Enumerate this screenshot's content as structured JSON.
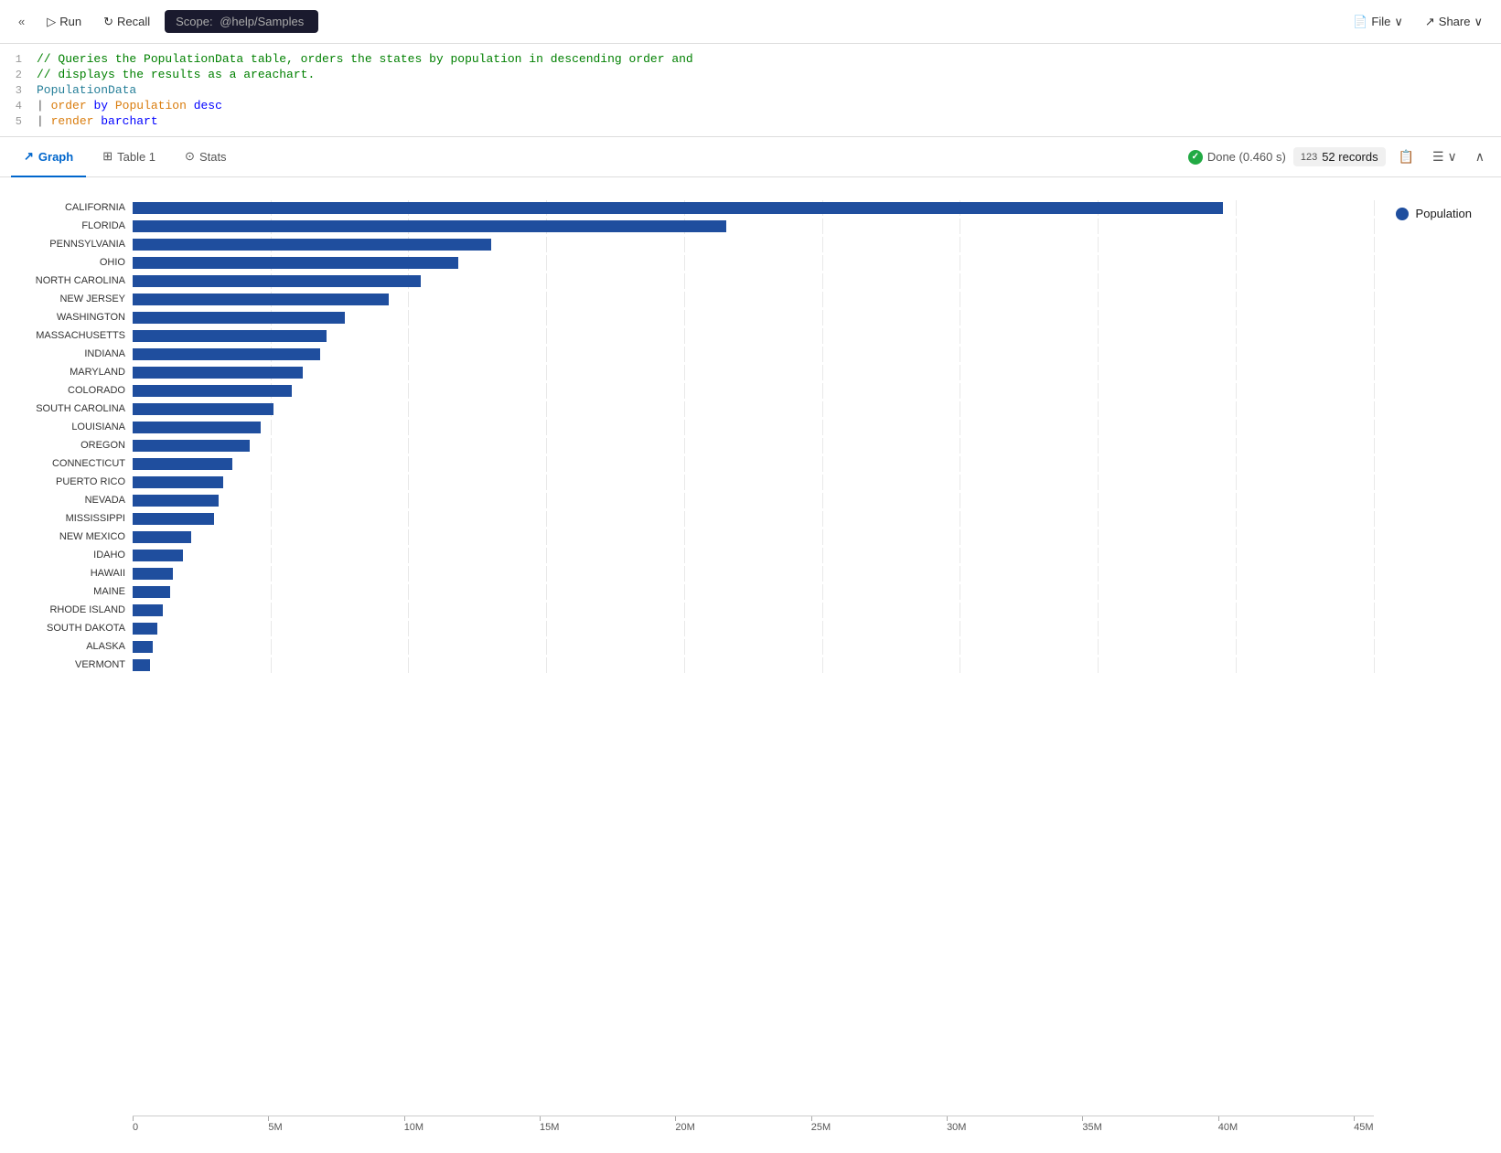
{
  "toolbar": {
    "back_label": "«",
    "run_label": "Run",
    "recall_label": "Recall",
    "scope_prefix": "Scope:",
    "scope_value": "@help/Samples",
    "file_label": "File",
    "share_label": "Share"
  },
  "code": {
    "lines": [
      {
        "num": "1",
        "content": "comment1",
        "text": "// Queries the PopulationData table, orders the states by population in descending order and"
      },
      {
        "num": "2",
        "content": "comment2",
        "text": "// displays the results as a areachart."
      },
      {
        "num": "3",
        "content": "type",
        "text": "PopulationData"
      },
      {
        "num": "4",
        "content": "pipe_order",
        "text": "| order by Population desc"
      },
      {
        "num": "5",
        "content": "pipe_render",
        "text": "| render    barchart"
      }
    ]
  },
  "results": {
    "tabs": [
      {
        "id": "graph",
        "label": "Graph",
        "icon": "📈",
        "active": true
      },
      {
        "id": "table1",
        "label": "Table 1",
        "icon": "⊞",
        "active": false
      },
      {
        "id": "stats",
        "label": "Stats",
        "icon": "⊙",
        "active": false
      }
    ],
    "status": "Done (0.460 s)",
    "records_icon": "123",
    "records_count": "52 records"
  },
  "chart": {
    "legend_label": "Population",
    "x_ticks": [
      "0",
      "5M",
      "10M",
      "15M",
      "20M",
      "25M",
      "30M",
      "35M",
      "40M",
      "45M"
    ],
    "max_value": 45000000,
    "bars": [
      {
        "label": "CALIFORNIA",
        "value": 39538223
      },
      {
        "label": "FLORIDA",
        "value": 21538187
      },
      {
        "label": "PENNSYLVANIA",
        "value": 13002700
      },
      {
        "label": "OHIO",
        "value": 11799448
      },
      {
        "label": "NORTH CAROLINA",
        "value": 10439388
      },
      {
        "label": "NEW JERSEY",
        "value": 9288994
      },
      {
        "label": "WASHINGTON",
        "value": 7705281
      },
      {
        "label": "MASSACHUSETTS",
        "value": 7029917
      },
      {
        "label": "INDIANA",
        "value": 6785528
      },
      {
        "label": "MARYLAND",
        "value": 6177224
      },
      {
        "label": "COLORADO",
        "value": 5773714
      },
      {
        "label": "SOUTH CAROLINA",
        "value": 5118425
      },
      {
        "label": "LOUISIANA",
        "value": 4657757
      },
      {
        "label": "OREGON",
        "value": 4237256
      },
      {
        "label": "CONNECTICUT",
        "value": 3605944
      },
      {
        "label": "PUERTO RICO",
        "value": 3285874
      },
      {
        "label": "NEVADA",
        "value": 3104614
      },
      {
        "label": "MISSISSIPPI",
        "value": 2961279
      },
      {
        "label": "NEW MEXICO",
        "value": 2117522
      },
      {
        "label": "IDAHO",
        "value": 1839106
      },
      {
        "label": "HAWAII",
        "value": 1455271
      },
      {
        "label": "MAINE",
        "value": 1362359
      },
      {
        "label": "RHODE ISLAND",
        "value": 1097379
      },
      {
        "label": "SOUTH DAKOTA",
        "value": 886667
      },
      {
        "label": "ALASKA",
        "value": 733391
      },
      {
        "label": "VERMONT",
        "value": 643077
      }
    ]
  }
}
